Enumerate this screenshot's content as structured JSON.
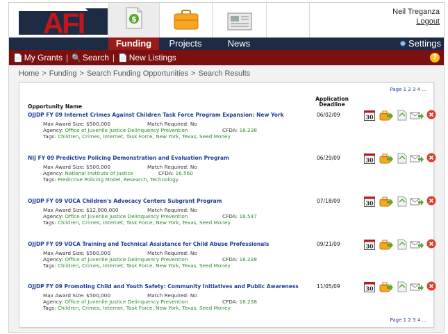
{
  "header": {
    "logo_text": "AFI",
    "user_name": "Neil Treganza",
    "logout_label": "Logout"
  },
  "nav": {
    "funding": "Funding",
    "projects": "Projects",
    "news": "News",
    "settings": "Settings"
  },
  "subnav": {
    "my_grants": "My Grants",
    "search": "Search",
    "new_listings": "New Listings"
  },
  "breadcrumb": [
    "Home",
    "Funding",
    "Search Funding Opportunities",
    "Search Results"
  ],
  "pager": "Page 1 2 3 4 ...",
  "columns": {
    "opportunity": "Opportunity Name",
    "deadline_line1": "Application",
    "deadline_line2": "Deadline"
  },
  "labels": {
    "max_award": "Max Award Size:",
    "match": "Match Required:",
    "agency": "Agency:",
    "cfda": "CFDA:",
    "tags": "Tags:",
    "calendar_day": "30"
  },
  "results": [
    {
      "title": "OJJDP FY 09 Internet Crimes Against Children Task Force Program Expansion: New York",
      "max_award": "$500,000",
      "match": "No",
      "agency": "Office of Juvenile Justice Delinquency Prevention",
      "cfda": "16.238",
      "tags": "Children, Crimes, Internet, Task Force, New York, Texas, Seed Money",
      "deadline": "06/02/09"
    },
    {
      "title": "NIJ FY 09 Predictive Policing Demonstration and Evaluation Program",
      "max_award": "$500,000",
      "match": "No",
      "agency": "National Institute of Justice",
      "cfda": "16.560",
      "tags": "Predictive Policing Model, Research, Technology",
      "deadline": "06/29/09"
    },
    {
      "title": "OJJDP FY 09 VOCA Children's Advocacy Centers Subgrant Program",
      "max_award": "$12,000,000",
      "match": "No",
      "agency": "Office of Juvenile Justice Delinquency Prevention",
      "cfda": "16.547",
      "tags": "Children, Crimes, Internet, Task Force, New York, Texas, Seed Money",
      "deadline": "07/18/09"
    },
    {
      "title": "OJJDP FY 09 VOCA Training and Technical Assistance for Child Abuse Professionals",
      "max_award": "$500,000",
      "match": "No",
      "agency": "Office of Juvenile Justice Delinquency Prevention",
      "cfda": "16.238",
      "tags": "Children, Crimes, Internet, Task Force, New York, Texas, Seed Money",
      "deadline": "09/21/09"
    },
    {
      "title": "OJJDP FY 09 Promoting Child and Youth Safety: Community Initiatives and Public Awareness",
      "max_award": "$500,000",
      "match": "No",
      "agency": "Office of Juvenile Justice Delinquency Prevention",
      "cfda": "16.238",
      "tags": "Children, Crimes, Internet, Task Force, New York, Texas, Seed Money",
      "deadline": "11/05/09"
    }
  ],
  "colors": {
    "brand_red": "#9b1a1a",
    "subnav_red": "#7a1010",
    "navy": "#1e2b44",
    "link_blue": "#1f3c9a",
    "tag_green": "#2e8b2e"
  }
}
